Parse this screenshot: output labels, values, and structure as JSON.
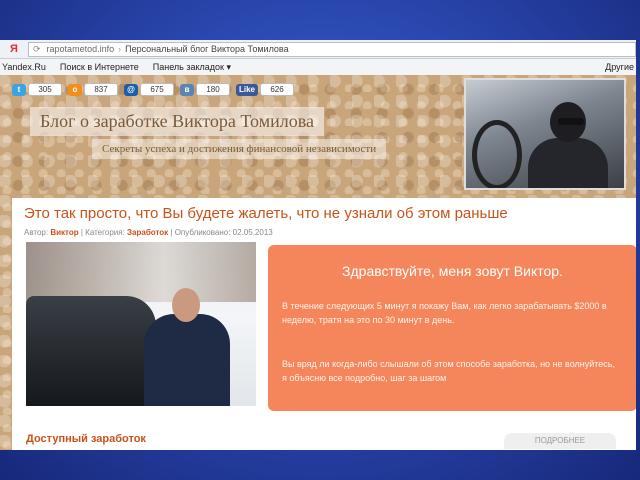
{
  "browser": {
    "logo": "Я",
    "url": "rapotametod.info",
    "page_title": "Персональный блог Виктора Томилова",
    "bookmarks": [
      "Yandex.Ru",
      "Поиск в Интернете",
      "Панель закладок ▾"
    ],
    "bookmarks_right": "Другие"
  },
  "social": [
    {
      "icon": "twitter-icon",
      "glyph": "t",
      "color": "#3aa3e3",
      "count": "305"
    },
    {
      "icon": "odnoklassniki-icon",
      "glyph": "о",
      "color": "#f28e1c",
      "count": "837"
    },
    {
      "icon": "mailru-icon",
      "glyph": "@",
      "color": "#1b5fa8",
      "count": "675"
    },
    {
      "icon": "vk-icon",
      "glyph": "в",
      "color": "#5b84b1",
      "count": "180"
    },
    {
      "icon": "facebook-like-icon",
      "glyph": "Like",
      "color": "#3b5998",
      "count": "626"
    }
  ],
  "header": {
    "title": "Блог о заработке Виктора Томилова",
    "subtitle": "Секреты успеха и достижения финансовой независимости"
  },
  "post": {
    "title": "Это так просто, что Вы будете жалеть, что не узнали об этом раньше",
    "meta_author_label": "Автор:",
    "meta_author": "Виктор",
    "meta_category_label": "| Категория:",
    "meta_category": "Заработок",
    "meta_date": "| Опубликовано: 02.05.2013",
    "greeting": "Здравствуйте, меня зовут Виктор.",
    "paragraph1": "В течение следующих 5 минут я покажу Вам, как легко зарабатывать $2000 в неделю, тратя на это по 30 минут в день.",
    "paragraph2": "Вы вряд ли когда-либо слышали об этом способе заработка, но не волнуйтесь, я объясню все подробно, шаг за шагом"
  },
  "footer_section": {
    "title": "Доступный заработок",
    "button": "ПОДРОБНЕЕ"
  }
}
